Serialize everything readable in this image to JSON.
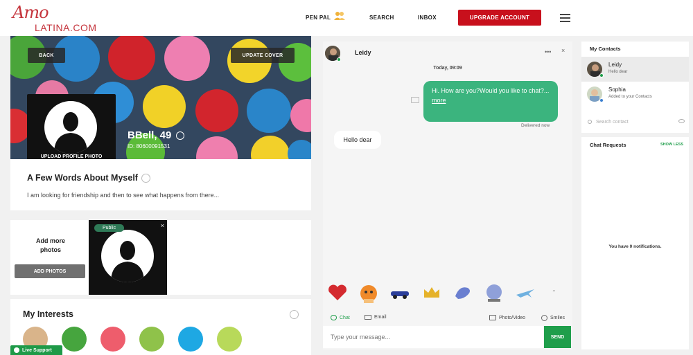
{
  "header": {
    "logo_script": "Amo",
    "logo_text": "LATINA.COM",
    "nav": [
      "PEN PAL",
      "SEARCH",
      "INBOX"
    ],
    "upgrade_label": "UPGRADE ACCOUNT"
  },
  "profile": {
    "back_label": "BACK",
    "update_cover_label": "UPDATE COVER",
    "upload_photo_label": "UPLOAD PROFILE PHOTO",
    "name_age": "BBell, 49",
    "id_text": "ID: 80600091531",
    "about_title": "A Few Words About Myself",
    "about_text": "I am looking for friendship and then to see what happens from there..."
  },
  "photos": {
    "add_more_text": "Add more photos",
    "add_photos_label": "ADD PHOTOS",
    "public_badge": "Public",
    "close_glyph": "×"
  },
  "interests": {
    "title": "My Interests",
    "icons": [
      {
        "icon": "cooking-icon",
        "color": "#d9b48a"
      },
      {
        "icon": "gaming-icon",
        "color": "#46a53e"
      },
      {
        "icon": "sports-icon",
        "color": "#ee5d6c"
      },
      {
        "icon": "travel-icon",
        "color": "#8fc24a"
      },
      {
        "icon": "swimming-icon",
        "color": "#1ea8e3"
      },
      {
        "icon": "nature-icon",
        "color": "#b8d95a"
      }
    ]
  },
  "live_support": "Live Support",
  "chat": {
    "contact_name": "Leidy",
    "dots": "•••",
    "close": "×",
    "date": "Today, 09:09",
    "outgoing": "Hi. How are you?Would you like to chat?...",
    "more_link": "more",
    "delivered": "Delivered now",
    "incoming": "Hello dear",
    "tab_chat": "Chat",
    "tab_email": "Email",
    "tab_photo_video": "Photo/Video",
    "tab_smiles": "Smiles",
    "input_placeholder": "Type your message...",
    "send_label": "SEND",
    "up_glyph": "⌃"
  },
  "contacts": {
    "title": "My Contacts",
    "items": [
      {
        "name": "Leidy",
        "sub": "Hello dear"
      },
      {
        "name": "Sophia",
        "sub": "Added to your Contacts"
      }
    ],
    "search_placeholder": "Search contact"
  },
  "requests": {
    "title": "Chat Requests",
    "show_less": "SHOW LESS",
    "empty_text": "You have 0 notifications."
  },
  "colors": {
    "brand_red": "#c8101c",
    "logo_red": "#c5343c",
    "accent_green": "#1f9e4b",
    "bubble_green": "#3bb47e"
  }
}
